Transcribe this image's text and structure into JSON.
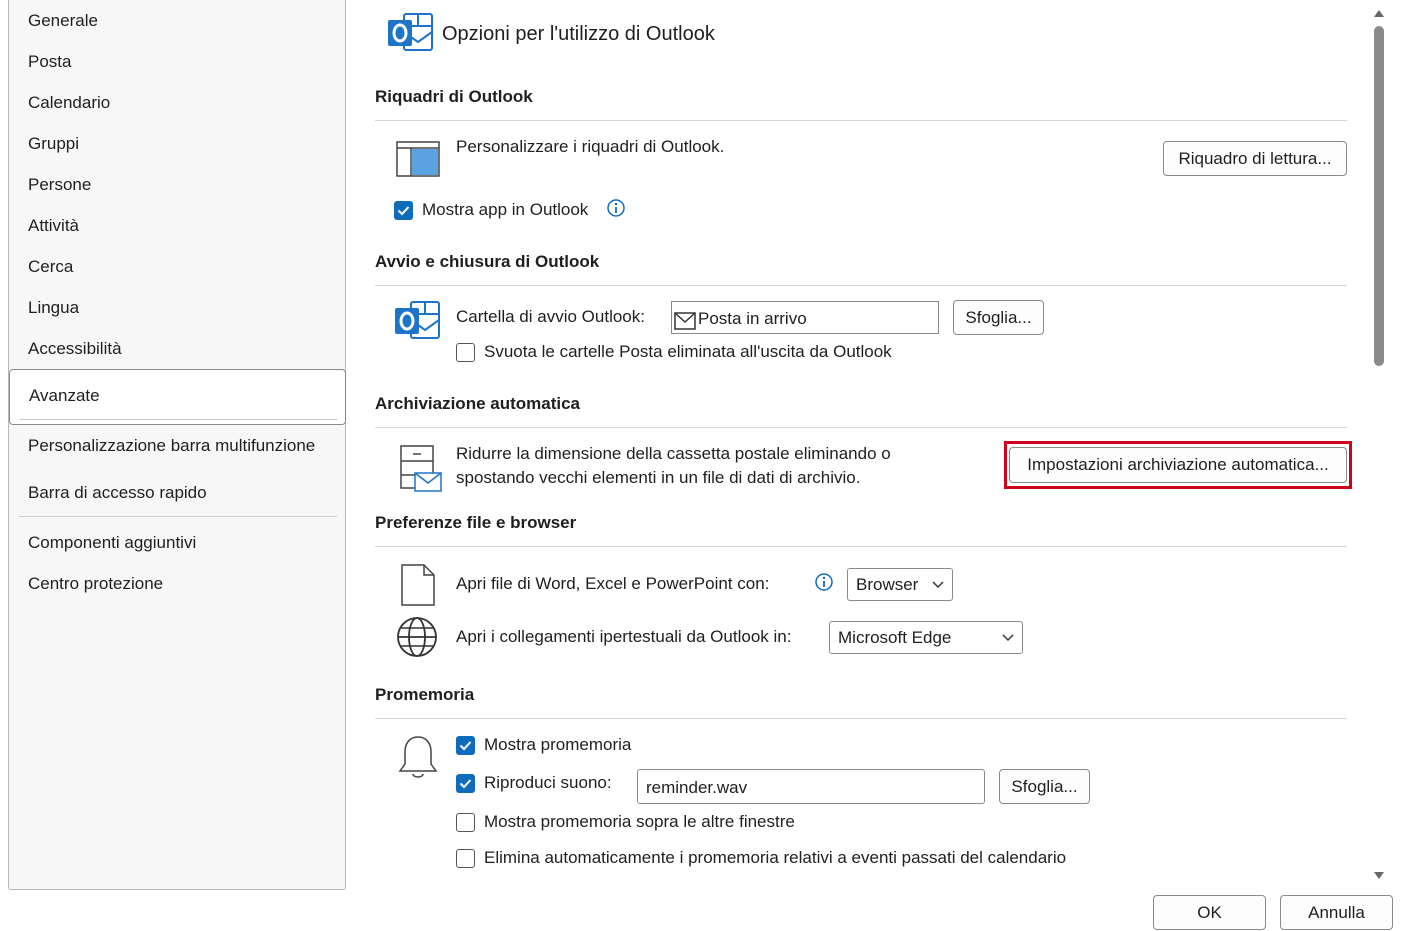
{
  "sidebar": {
    "items": [
      {
        "label": "Generale"
      },
      {
        "label": "Posta"
      },
      {
        "label": "Calendario"
      },
      {
        "label": "Gruppi"
      },
      {
        "label": "Persone"
      },
      {
        "label": "Attività"
      },
      {
        "label": "Cerca"
      },
      {
        "label": "Lingua"
      },
      {
        "label": "Accessibilità"
      },
      {
        "label": "Avanzate"
      },
      {
        "label": "Personalizzazione barra multifunzione"
      },
      {
        "label": "Barra di accesso rapido"
      },
      {
        "label": "Componenti aggiuntivi"
      },
      {
        "label": "Centro protezione"
      }
    ],
    "selected": "Avanzate"
  },
  "header": {
    "title": "Opzioni per l'utilizzo di Outlook",
    "icon": "outlook-icon"
  },
  "sections": {
    "riquadri": {
      "title": "Riquadri di Outlook",
      "description": "Personalizzare i riquadri di Outlook.",
      "button": "Riquadro di lettura...",
      "checkbox_label": "Mostra app in Outlook",
      "checkbox_checked": true
    },
    "avvio": {
      "title": "Avvio e chiusura di Outlook",
      "folder_label": "Cartella di avvio Outlook:",
      "folder_value": "Posta in arrivo",
      "browse_button": "Sfoglia...",
      "empty_deleted_label": "Svuota le cartelle Posta eliminata all'uscita da Outlook",
      "empty_deleted_checked": false
    },
    "archiviazione": {
      "title": "Archiviazione automatica",
      "description_line1": "Ridurre la dimensione della cassetta postale eliminando o",
      "description_line2": "spostando vecchi elementi in un file di dati di archivio.",
      "button": "Impostazioni archiviazione automatica..."
    },
    "preferenze": {
      "title": "Preferenze file e browser",
      "open_files_label": "Apri file di Word, Excel e PowerPoint con:",
      "open_files_value": "Browser",
      "open_links_label": "Apri i collegamenti ipertestuali da Outlook in:",
      "open_links_value": "Microsoft Edge"
    },
    "promemoria": {
      "title": "Promemoria",
      "show_label": "Mostra promemoria",
      "show_checked": true,
      "sound_label": "Riproduci suono:",
      "sound_checked": true,
      "sound_file": "reminder.wav",
      "browse_button": "Sfoglia...",
      "on_top_label": "Mostra promemoria sopra le altre finestre",
      "on_top_checked": false,
      "auto_dismiss_label": "Elimina automaticamente i promemoria relativi a eventi passati del calendario",
      "auto_dismiss_checked": false
    }
  },
  "footer": {
    "ok": "OK",
    "cancel": "Annulla"
  },
  "colors": {
    "accent": "#0f6cbd",
    "highlight": "#d0021b",
    "outlook_blue": "#1e74c8"
  }
}
